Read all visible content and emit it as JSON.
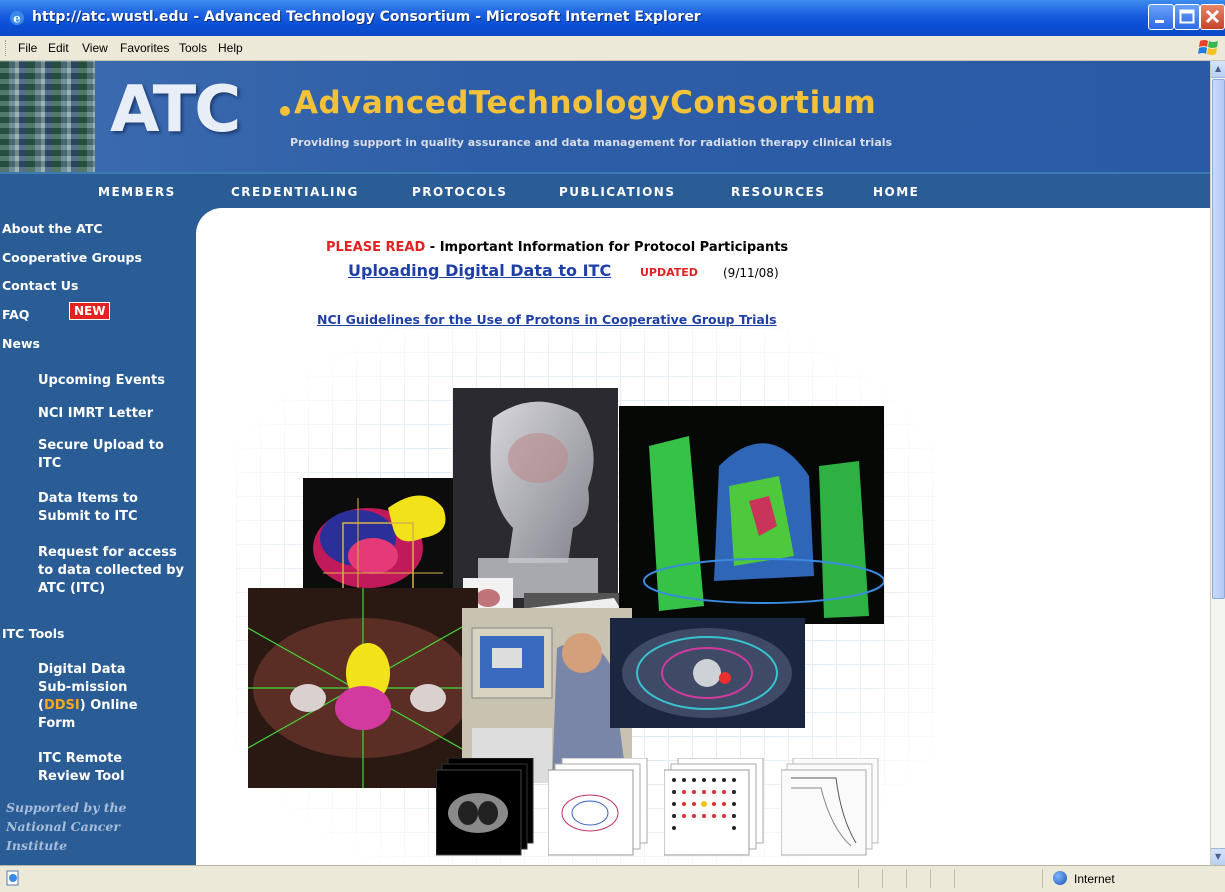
{
  "window": {
    "title": "http://atc.wustl.edu - Advanced Technology Consortium - Microsoft Internet Explorer"
  },
  "menu": [
    "File",
    "Edit",
    "View",
    "Favorites",
    "Tools",
    "Help"
  ],
  "banner": {
    "logo": "ATC",
    "name": "AdvancedTechnologyConsortium",
    "tagline": "Providing support in quality assurance and data management for radiation therapy clinical trials"
  },
  "nav": [
    "MEMBERS",
    "CREDENTIALING",
    "PROTOCOLS",
    "PUBLICATIONS",
    "RESOURCES",
    "HOME"
  ],
  "sidebar": {
    "top": [
      "About the ATC",
      "Cooperative Groups",
      "Contact Us",
      "FAQ",
      "News"
    ],
    "new_badge": "NEW",
    "news_items": [
      "Upcoming Events",
      "NCI IMRT Letter",
      "Secure Upload to ITC",
      "Data Items to Submit to ITC",
      "Request for access to data collected by ATC (ITC)"
    ],
    "itc_tools": "ITC Tools",
    "ddsi_pre": "Digital Data Sub-mission (",
    "ddsi_mid": "DDSI",
    "ddsi_post": ") Online Form",
    "remote_review": "ITC Remote Review Tool",
    "support": "Supported by the National Cancer Institute"
  },
  "content": {
    "please_read": "PLEASE READ",
    "important": " - Important Information for Protocol Participants",
    "upload_link": "Uploading Digital Data to ITC",
    "updated": "UPDATED",
    "date": "(9/11/08)",
    "nci_link": "NCI Guidelines for the Use of Protons in Cooperative Group Trials"
  },
  "status": {
    "zone": "Internet"
  },
  "colors": {
    "nav_bg": "#2a5c96",
    "link": "#1f3fa8",
    "alert_red": "#e42020",
    "banner_accent": "#f3c23a"
  }
}
